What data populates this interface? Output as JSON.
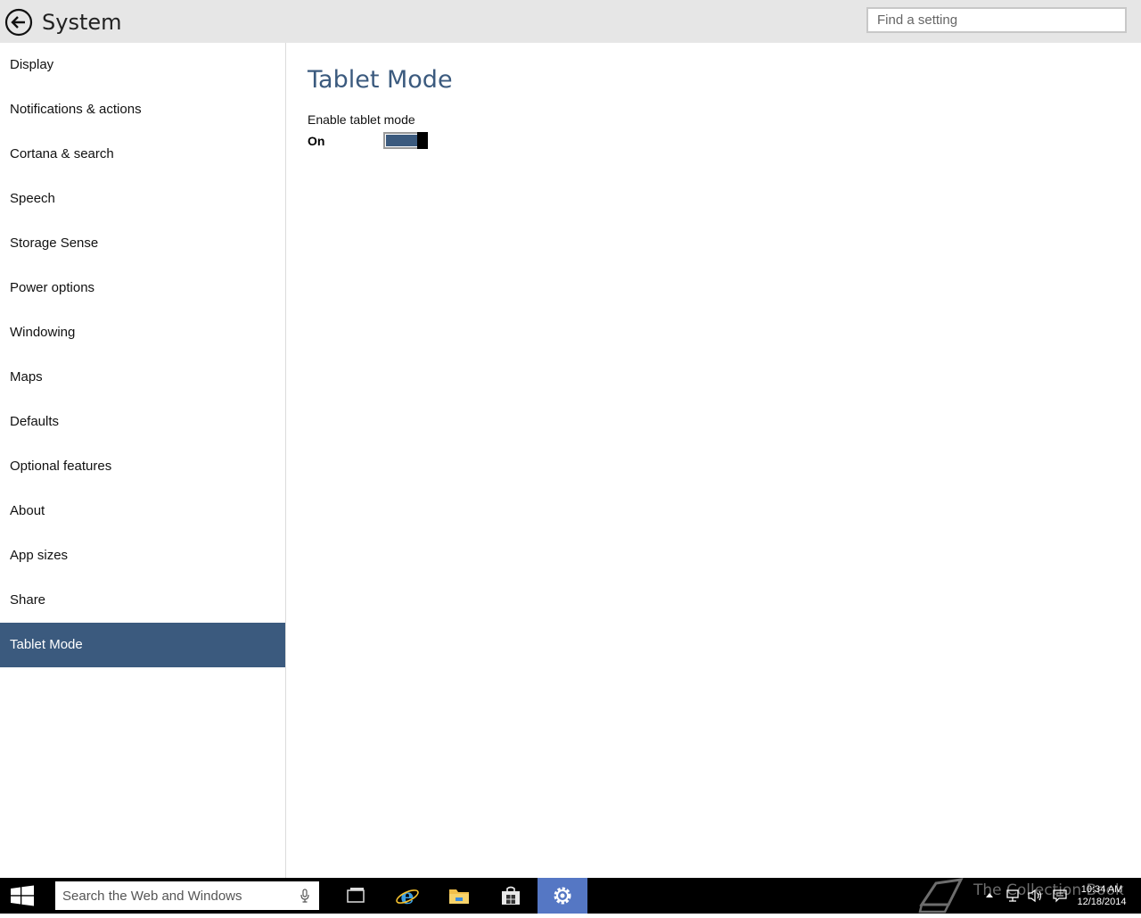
{
  "window": {
    "title": "System",
    "search_placeholder": "Find a setting"
  },
  "sidebar": {
    "items": [
      {
        "label": "Display"
      },
      {
        "label": "Notifications & actions"
      },
      {
        "label": "Cortana & search"
      },
      {
        "label": "Speech"
      },
      {
        "label": "Storage Sense"
      },
      {
        "label": "Power options"
      },
      {
        "label": "Windowing"
      },
      {
        "label": "Maps"
      },
      {
        "label": "Defaults"
      },
      {
        "label": "Optional features"
      },
      {
        "label": "About"
      },
      {
        "label": "App sizes"
      },
      {
        "label": "Share"
      },
      {
        "label": "Tablet Mode",
        "selected": true
      }
    ]
  },
  "content": {
    "heading": "Tablet Mode",
    "setting_label": "Enable tablet mode",
    "toggle_state": "On",
    "toggle_on": true
  },
  "taskbar": {
    "search_placeholder": "Search the Web and Windows",
    "apps": [
      "task-view-icon",
      "internet-explorer-icon",
      "file-explorer-icon",
      "store-icon",
      "settings-icon"
    ],
    "active_app": "settings-icon",
    "watermark": "The Collection Book",
    "time": "10:34 AM",
    "date": "12/18/2014"
  },
  "colors": {
    "accent": "#3b5a7e",
    "titlebar": "#e6e6e6",
    "taskbar": "#000000",
    "taskbar_active": "#5577c4"
  }
}
